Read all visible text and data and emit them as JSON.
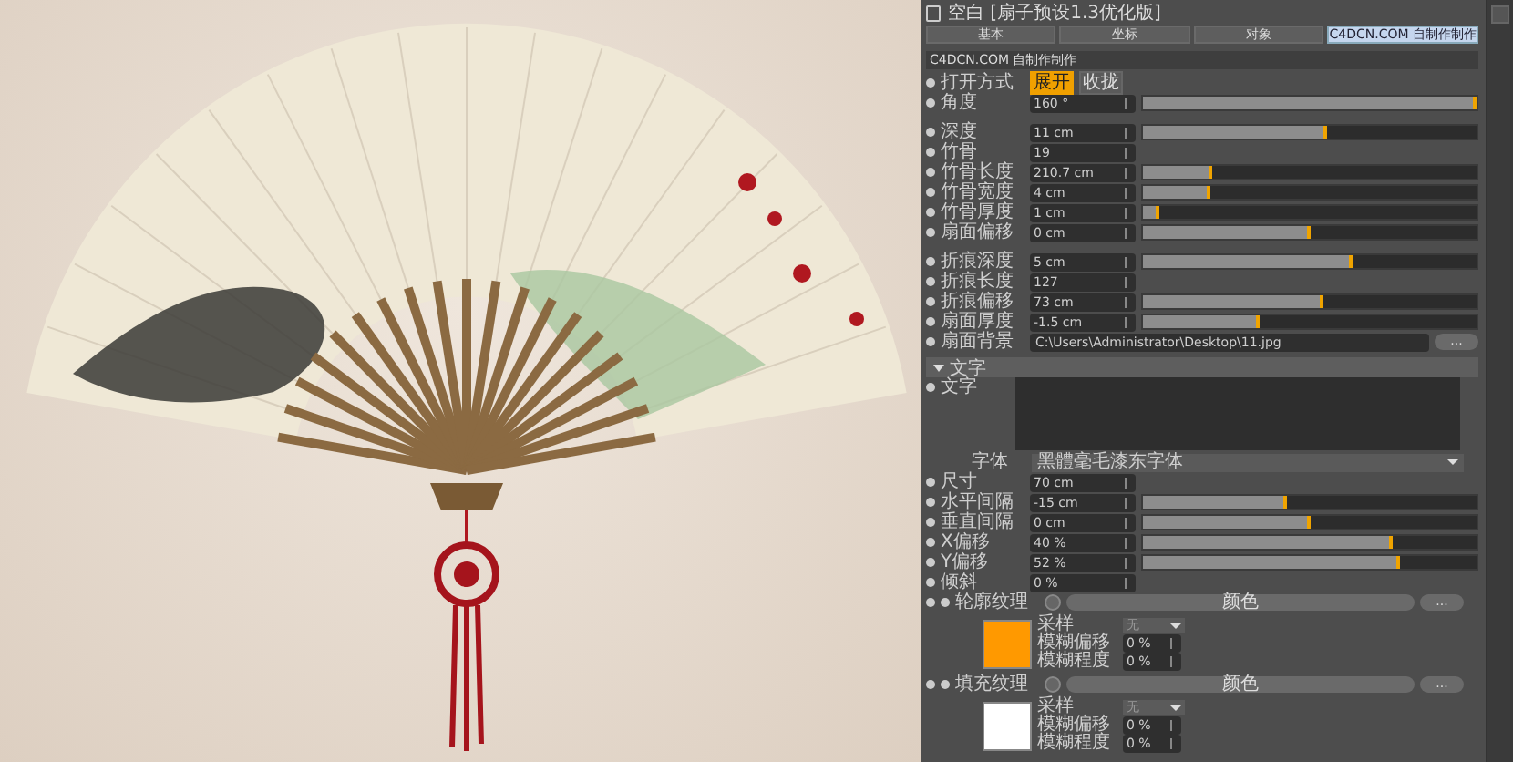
{
  "window": {
    "title": "空白 [扇子预设1.3优化版]"
  },
  "tabs": [
    {
      "label": "基本",
      "selected": false
    },
    {
      "label": "坐标",
      "selected": false
    },
    {
      "label": "对象",
      "selected": false
    },
    {
      "label": "C4DCN.COM 自制作制作",
      "selected": true
    }
  ],
  "group_title": "C4DCN.COM 自制作制作",
  "rows": [
    {
      "kind": "choice",
      "label": "打开方式",
      "options": [
        {
          "label": "展开",
          "selected": true
        },
        {
          "label": "收拢",
          "selected": false
        }
      ]
    },
    {
      "kind": "slider",
      "label": "角度",
      "value": "160 °",
      "level": 1.0
    },
    {
      "kind": "slider",
      "label": "深度",
      "value": "11 cm",
      "level": 0.55,
      "separated": true
    },
    {
      "kind": "number",
      "label": "竹骨",
      "value": "19"
    },
    {
      "kind": "slider",
      "label": "竹骨长度",
      "value": "210.7 cm",
      "level": 0.21
    },
    {
      "kind": "slider",
      "label": "竹骨宽度",
      "value": "4 cm",
      "level": 0.2
    },
    {
      "kind": "slider",
      "label": "竹骨厚度",
      "value": "1 cm",
      "level": 0.05
    },
    {
      "kind": "slider",
      "label": "扇面偏移",
      "value": "0 cm",
      "level": 0.5
    },
    {
      "kind": "slider",
      "label": "折痕深度",
      "value": "5 cm",
      "level": 0.63,
      "separated": true
    },
    {
      "kind": "number",
      "label": "折痕长度",
      "value": "127"
    },
    {
      "kind": "slider",
      "label": "折痕偏移",
      "value": "73 cm",
      "level": 0.54
    },
    {
      "kind": "slider",
      "label": "扇面厚度",
      "value": "-1.5 cm",
      "level": 0.35
    },
    {
      "kind": "path",
      "label": "扇面背景",
      "value": "C:\\Users\\Administrator\\Desktop\\11.jpg",
      "button": "..."
    },
    {
      "kind": "section",
      "label": "文字"
    },
    {
      "kind": "text",
      "label": "文字"
    },
    {
      "kind": "font",
      "label": "字体",
      "value": "黑體毫毛漆东字体"
    },
    {
      "kind": "number",
      "label": "尺寸",
      "value": "70 cm"
    },
    {
      "kind": "slider",
      "label": "水平间隔",
      "value": "-15 cm",
      "level": 0.43
    },
    {
      "kind": "slider",
      "label": "垂直间隔",
      "value": "0 cm",
      "level": 0.5
    },
    {
      "kind": "slider",
      "label": "X偏移",
      "value": "40 %",
      "level": 0.75
    },
    {
      "kind": "slider",
      "label": "Y偏移",
      "value": "52 %",
      "level": 0.77
    },
    {
      "kind": "number",
      "label": "倾斜",
      "value": "0 %"
    },
    {
      "kind": "texture",
      "label": "轮廓纹理",
      "button": "颜色",
      "more": "...",
      "color": "#ff9900",
      "sampling_label": "采样",
      "sampling": "无",
      "params": [
        {
          "label": "模糊偏移",
          "value": "0 %"
        },
        {
          "label": "模糊程度",
          "value": "0 %"
        }
      ]
    },
    {
      "kind": "texture",
      "label": "填充纹理",
      "button": "颜色",
      "more": "...",
      "color": "#ffffff",
      "sampling_label": "采样",
      "sampling": "无",
      "params": [
        {
          "label": "模糊偏移",
          "value": "0 %"
        },
        {
          "label": "模糊程度",
          "value": "0 %"
        }
      ]
    }
  ]
}
